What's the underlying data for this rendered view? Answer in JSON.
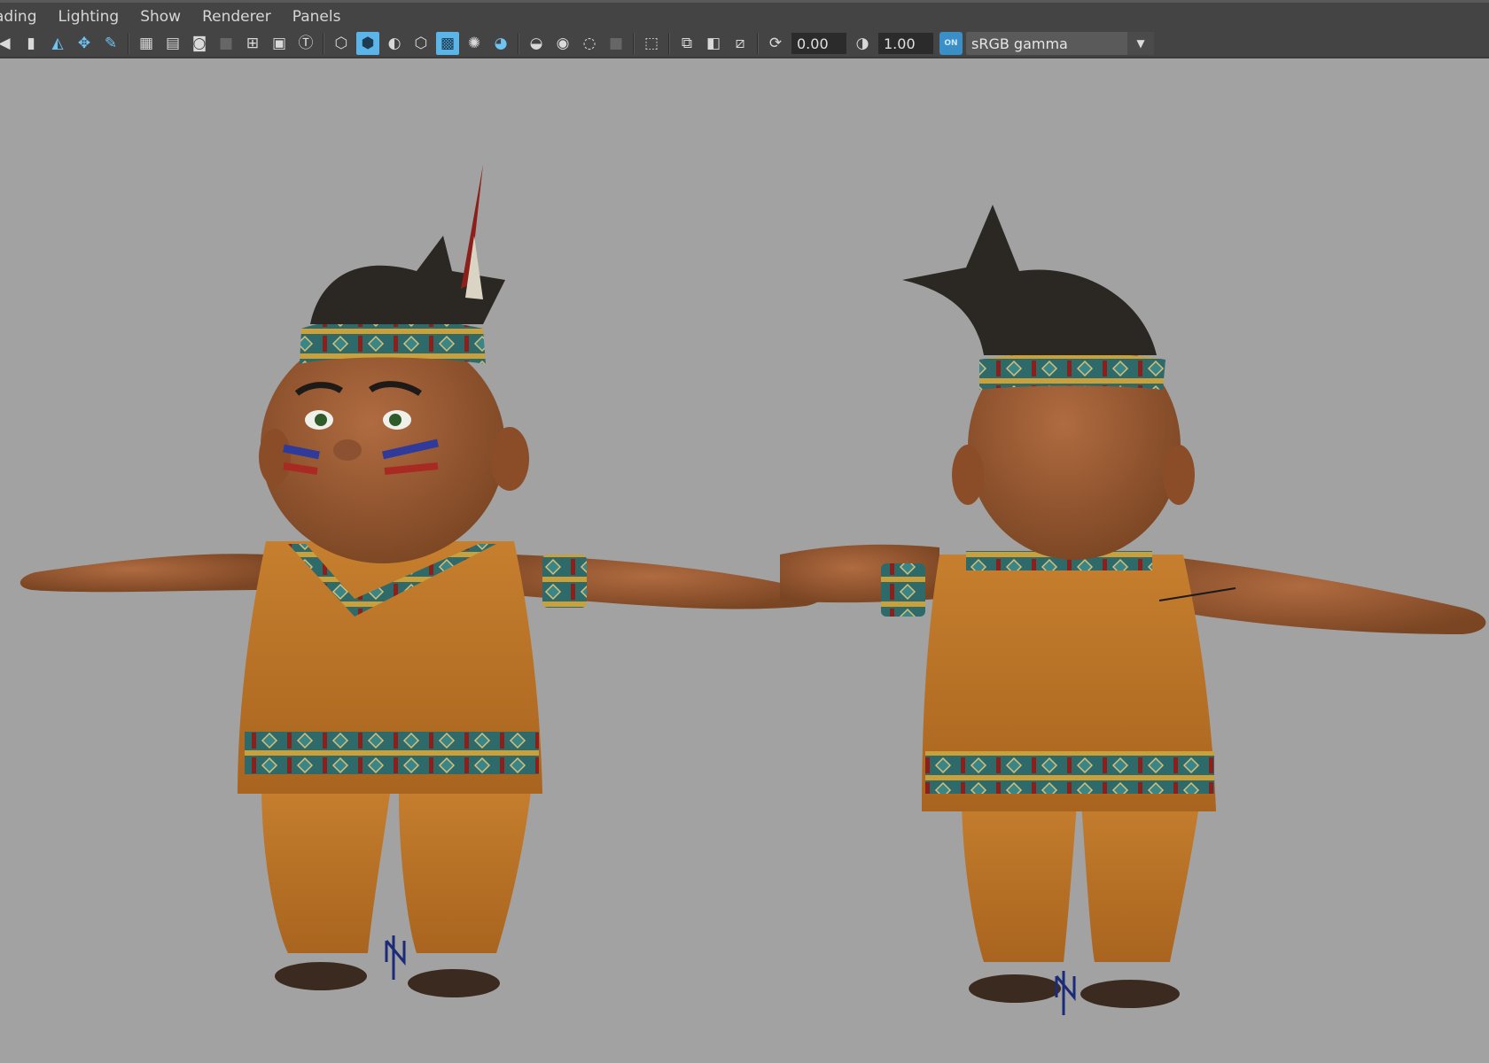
{
  "menubar": {
    "items": [
      "ading",
      "Lighting",
      "Show",
      "Renderer",
      "Panels"
    ]
  },
  "toolbar": {
    "exposure_value": "0.00",
    "gamma_value": "1.00",
    "color_management_badge": "ON",
    "view_transform": "sRGB gamma"
  },
  "icons": [
    "prev-icon",
    "bookmark-icon",
    "camera-attributes-icon",
    "image-plane-icon",
    "pencil-icon",
    "grid-icon",
    "film-gate-icon",
    "resolution-gate-icon",
    "gate-mask-icon",
    "field-chart-icon",
    "safe-action-icon",
    "safe-title-icon",
    "wireframe-icon",
    "smooth-shade-icon",
    "default-material-icon",
    "wireframe-on-shaded-icon",
    "xray-icon",
    "lights-icon",
    "shadows-icon",
    "ambient-occlusion-icon",
    "motion-blur-icon",
    "antialiasing-icon",
    "dof-icon",
    "isolate-select-icon",
    "xray-joints-icon",
    "xray-active-icon",
    "backface-culling-icon",
    "exposure-icon",
    "gamma-icon",
    "color-management-icon"
  ]
}
